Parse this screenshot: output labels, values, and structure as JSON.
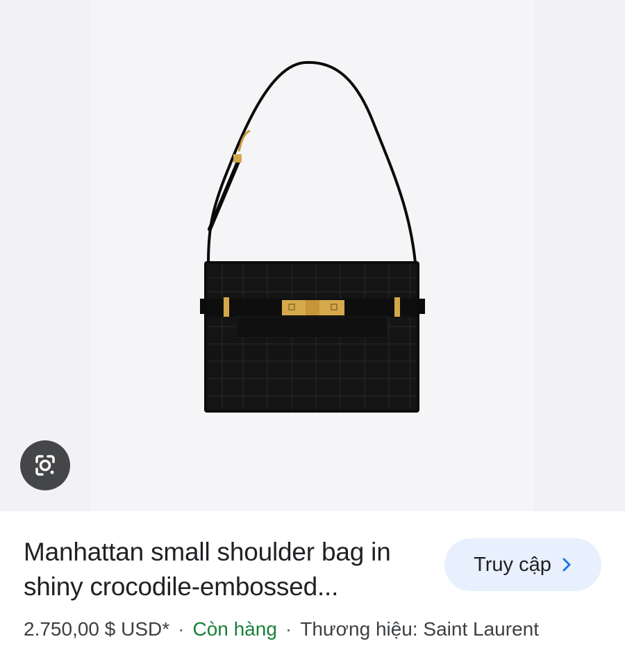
{
  "product": {
    "title_line1": "Manhattan small shoulder bag in",
    "title_line2": "shiny crocodile-embossed...",
    "price": "2.750,00 $ USD*",
    "separator": "·",
    "stock": "Còn hàng",
    "brand": "Thương hiệu: Saint Laurent"
  },
  "actions": {
    "visit_label": "Truy cập",
    "visit_icon": "chevron-right-icon",
    "lens_icon": "google-lens-icon"
  },
  "colors": {
    "stock_green": "#188038",
    "button_bg": "#e8effd",
    "chevron_blue": "#1a73e8",
    "lens_bg": "#454648"
  }
}
